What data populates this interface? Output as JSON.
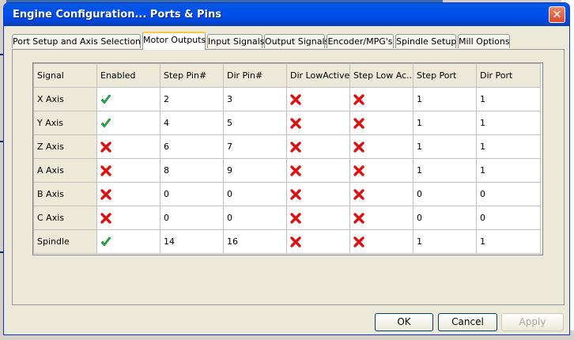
{
  "window": {
    "title": "Engine Configuration... Ports & Pins",
    "close_glyph": "✕"
  },
  "tabs": [
    {
      "label": "Port Setup and Axis Selection",
      "active": false
    },
    {
      "label": "Motor Outputs",
      "active": true
    },
    {
      "label": "Input Signals",
      "active": false
    },
    {
      "label": "Output Signals",
      "active": false
    },
    {
      "label": "Encoder/MPG's",
      "active": false
    },
    {
      "label": "Spindle Setup",
      "active": false
    },
    {
      "label": "Mill Options",
      "active": false
    }
  ],
  "table": {
    "columns": [
      "Signal",
      "Enabled",
      "Step Pin#",
      "Dir Pin#",
      "Dir LowActive",
      "Step Low Ac...",
      "Step Port",
      "Dir Port"
    ],
    "rows": [
      {
        "signal": "X Axis",
        "enabled": true,
        "step_pin": "2",
        "dir_pin": "3",
        "dir_low_active": false,
        "step_low_active": false,
        "step_port": "1",
        "dir_port": "1"
      },
      {
        "signal": "Y Axis",
        "enabled": true,
        "step_pin": "4",
        "dir_pin": "5",
        "dir_low_active": false,
        "step_low_active": false,
        "step_port": "1",
        "dir_port": "1"
      },
      {
        "signal": "Z Axis",
        "enabled": false,
        "step_pin": "6",
        "dir_pin": "7",
        "dir_low_active": false,
        "step_low_active": false,
        "step_port": "1",
        "dir_port": "1"
      },
      {
        "signal": "A Axis",
        "enabled": false,
        "step_pin": "8",
        "dir_pin": "9",
        "dir_low_active": false,
        "step_low_active": false,
        "step_port": "1",
        "dir_port": "1"
      },
      {
        "signal": "B Axis",
        "enabled": false,
        "step_pin": "0",
        "dir_pin": "0",
        "dir_low_active": false,
        "step_low_active": false,
        "step_port": "0",
        "dir_port": "0"
      },
      {
        "signal": "C Axis",
        "enabled": false,
        "step_pin": "0",
        "dir_pin": "0",
        "dir_low_active": false,
        "step_low_active": false,
        "step_port": "0",
        "dir_port": "0"
      },
      {
        "signal": "Spindle",
        "enabled": true,
        "step_pin": "14",
        "dir_pin": "16",
        "dir_low_active": false,
        "step_low_active": false,
        "step_port": "1",
        "dir_port": "1"
      }
    ]
  },
  "icons": {
    "enabled_true": "green-check-icon",
    "enabled_false": "red-x-icon"
  },
  "colors": {
    "check": "#22b14c",
    "cross": "#e01010",
    "titlebar": "#0053e3"
  },
  "buttons": {
    "ok": "OK",
    "cancel": "Cancel",
    "apply": "Apply"
  }
}
